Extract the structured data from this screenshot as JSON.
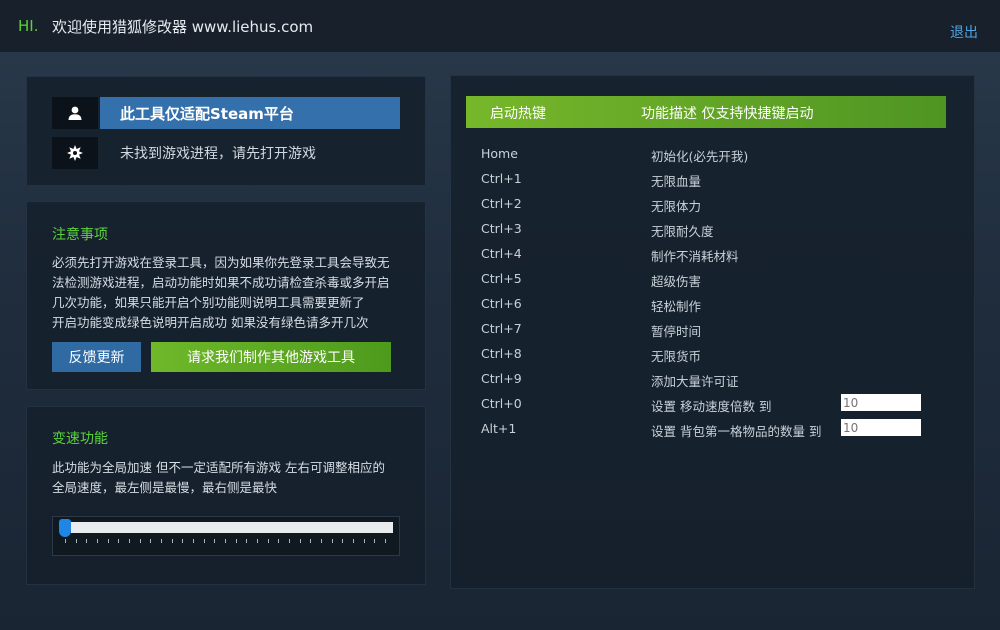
{
  "header": {
    "hi": "HI.",
    "welcome": "欢迎使用猎狐修改器 www.liehus.com",
    "logout": "退出"
  },
  "status": {
    "platform": "此工具仅适配Steam平台",
    "process": "未找到游戏进程，请先打开游戏"
  },
  "notes": {
    "title": "注意事项",
    "lines": [
      "必须先打开游戏在登录工具，因为如果你先登录工具会导致无",
      "法检测游戏进程，启动功能时如果不成功请检查杀毒或多开启",
      "几次功能，如果只能开启个别功能则说明工具需要更新了",
      "开启功能变成绿色说明开启成功 如果没有绿色请多开几次"
    ],
    "feedback_button": "反馈更新",
    "request_button": "请求我们制作其他游戏工具"
  },
  "speed": {
    "title": "变速功能",
    "lines": [
      "此功能为全局加速 但不一定适配所有游戏 左右可调整相应的",
      "全局速度，最左侧是最慢，最右侧是最快"
    ],
    "slider_value_fraction": 0
  },
  "hotkeys": {
    "col_key": "启动热键",
    "col_desc": "功能描述 仅支持快捷键启动",
    "rows": [
      {
        "key": "Home",
        "desc": "初始化(必先开我)"
      },
      {
        "key": "Ctrl+1",
        "desc": "无限血量"
      },
      {
        "key": "Ctrl+2",
        "desc": "无限体力"
      },
      {
        "key": "Ctrl+3",
        "desc": "无限耐久度"
      },
      {
        "key": "Ctrl+4",
        "desc": "制作不消耗材料"
      },
      {
        "key": "Ctrl+5",
        "desc": "超级伤害"
      },
      {
        "key": "Ctrl+6",
        "desc": "轻松制作"
      },
      {
        "key": "Ctrl+7",
        "desc": "暂停时间"
      },
      {
        "key": "Ctrl+8",
        "desc": "无限货币"
      },
      {
        "key": "Ctrl+9",
        "desc": "添加大量许可证"
      },
      {
        "key": "Ctrl+0",
        "desc": "设置 移动速度倍数 到",
        "input": "10"
      },
      {
        "key": "Alt+1",
        "desc": "设置 背包第一格物品的数量 到",
        "input": "10"
      }
    ]
  },
  "colors": {
    "accent_green": "#5bd23a",
    "header_blue": "#3470ab",
    "link_blue": "#4fa3e0"
  },
  "icons": {
    "user": "user-icon",
    "gear": "gear-icon"
  }
}
